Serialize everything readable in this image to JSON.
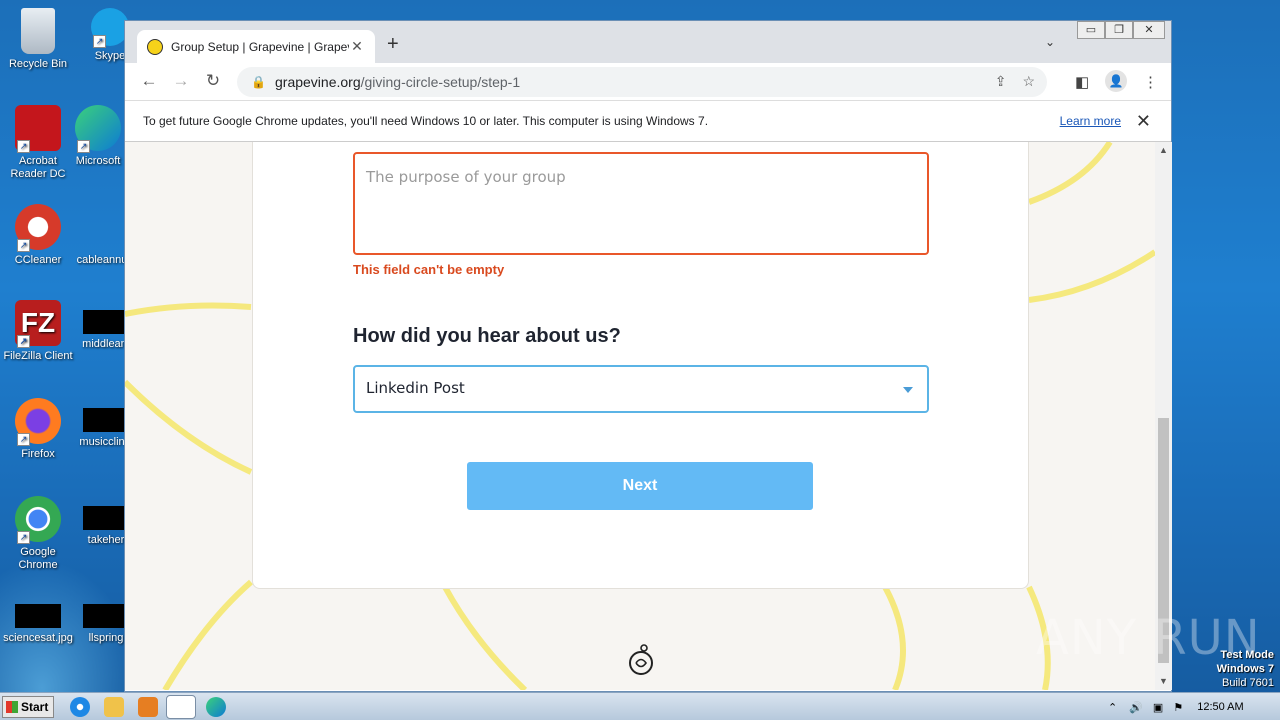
{
  "desktop": {
    "icons": [
      {
        "label": "Recycle Bin",
        "color": "#cfd8e0"
      },
      {
        "label": "Skype",
        "color": "#1aa1e4"
      },
      {
        "label": "Acrobat Reader DC",
        "color": "#c4161c"
      },
      {
        "label": "Microsoft",
        "color": "#0d7bd4"
      },
      {
        "label": "CCleaner",
        "color": "#d63a2a"
      },
      {
        "label": "cableannu",
        "color": "#000000"
      },
      {
        "label": "FileZilla Client",
        "color": "#b81e1e"
      },
      {
        "label": "middleam",
        "color": "#000000"
      },
      {
        "label": "Firefox",
        "color": "#ff7b20"
      },
      {
        "label": "musicclinic",
        "color": "#000000"
      },
      {
        "label": "Google Chrome",
        "color": "#4285f4"
      },
      {
        "label": "takeher",
        "color": "#000000"
      },
      {
        "label": "sciencesat.jpg",
        "color": "#000000"
      },
      {
        "label": "llspring",
        "color": "#000000"
      }
    ]
  },
  "browser": {
    "tab_title": "Group Setup | Grapevine | Grapevine",
    "url_host": "grapevine.org",
    "url_path": "/giving-circle-setup/step-1",
    "infobar_text": "To get future Google Chrome updates, you'll need Windows 10 or later. This computer is using Windows 7.",
    "infobar_link": "Learn more"
  },
  "form": {
    "purpose_placeholder": "The purpose of your group",
    "purpose_error": "This field can't be empty",
    "hear_question": "How did you hear about us?",
    "hear_selected": "Linkedin Post",
    "next_label": "Next"
  },
  "taskbar": {
    "start_label": "Start",
    "clock": "12:50 AM"
  },
  "overlay": {
    "watermark": "ANY RUN",
    "testmode_line1": "Test Mode",
    "testmode_line2": "Windows 7",
    "testmode_line3": "Build 7601"
  }
}
